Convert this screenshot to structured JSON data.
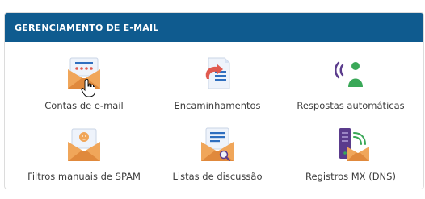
{
  "panel": {
    "title": "GERENCIAMENTO DE E-MAIL"
  },
  "tiles": [
    {
      "label": "Contas de e-mail",
      "icon": "envelope-icon"
    },
    {
      "label": "Encaminhamentos",
      "icon": "forward-document-icon"
    },
    {
      "label": "Respostas automáticas",
      "icon": "autoresponder-person-icon"
    },
    {
      "label": "Filtros manuais de SPAM",
      "icon": "spam-filter-envelope-icon"
    },
    {
      "label": "Listas de discussão",
      "icon": "mailing-list-envelope-icon"
    },
    {
      "label": "Registros MX (DNS)",
      "icon": "mx-server-icon"
    }
  ],
  "colors": {
    "header": "#0f5b8f",
    "envelope": "#f0a65a",
    "envelope_dark": "#e0893c",
    "paper": "#eef3fb",
    "blue": "#2f6fbf",
    "red": "#e05a4f",
    "green": "#3aa858",
    "purple": "#5a3b8c"
  }
}
